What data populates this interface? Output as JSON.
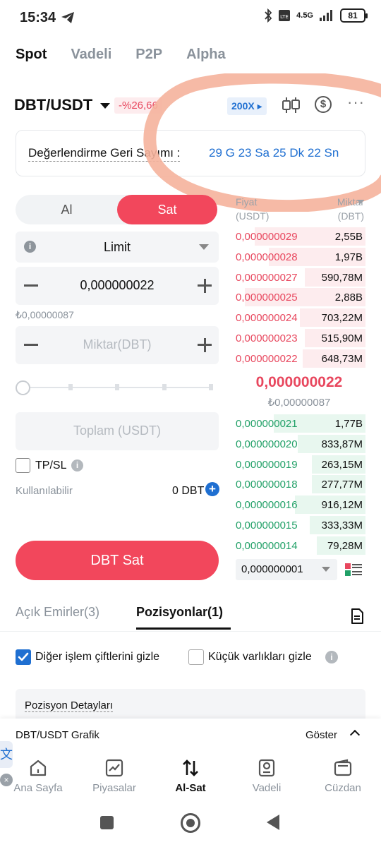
{
  "status_bar": {
    "time": "15:34",
    "battery": "81",
    "network": "4.5G"
  },
  "top_tabs": [
    {
      "label": "Spot",
      "active": true
    },
    {
      "label": "Vadeli",
      "active": false
    },
    {
      "label": "P2P",
      "active": false
    },
    {
      "label": "Alpha",
      "active": false
    }
  ],
  "pair": {
    "name": "DBT/USDT",
    "change": "-%26,66",
    "leverage": "200X"
  },
  "countdown": {
    "label": "Değerlendirme Geri Sayımı :",
    "value": "29 G 23 Sa 25 Dk 22 Sn"
  },
  "order_form": {
    "buy_label": "Al",
    "sell_label": "Sat",
    "order_type": "Limit",
    "price_value": "0,000000022",
    "price_sub": "₺0,00000087",
    "amount_placeholder": "Miktar(DBT)",
    "total_placeholder": "Toplam (USDT)",
    "tpsl_label": "TP/SL",
    "available_label": "Kullanılabilir",
    "available_value": "0 DBT",
    "sell_button": "DBT Sat",
    "slider_percent": 0
  },
  "orderbook": {
    "price_header": "Fiyat\n(USDT)",
    "amount_header": "Miktar\n(DBT)",
    "asks": [
      {
        "price": "0,000000029",
        "amount": "2,55B",
        "depth": 0.27
      },
      {
        "price": "0,000000028",
        "amount": "1,97B",
        "depth": 0.21
      },
      {
        "price": "0,000000027",
        "amount": "590,78M",
        "depth": 0.06
      },
      {
        "price": "0,000000025",
        "amount": "2,88B",
        "depth": 0.31
      },
      {
        "price": "0,000000024",
        "amount": "703,22M",
        "depth": 0.08
      },
      {
        "price": "0,000000023",
        "amount": "515,90M",
        "depth": 0.06
      },
      {
        "price": "0,000000022",
        "amount": "648,73M",
        "depth": 0.07
      }
    ],
    "last_price": "0,000000022",
    "last_price_try": "₺0,00000087",
    "bids": [
      {
        "price": "0,000000021",
        "amount": "1,77B",
        "depth": 0.19
      },
      {
        "price": "0,000000020",
        "amount": "833,87M",
        "depth": 0.09
      },
      {
        "price": "0,000000019",
        "amount": "263,15M",
        "depth": 0.03
      },
      {
        "price": "0,000000018",
        "amount": "277,77M",
        "depth": 0.03
      },
      {
        "price": "0,000000016",
        "amount": "916,12M",
        "depth": 0.1
      },
      {
        "price": "0,000000015",
        "amount": "333,33M",
        "depth": 0.04
      },
      {
        "price": "0,000000014",
        "amount": "79,28M",
        "depth": 0.01
      }
    ],
    "precision": "0,000000001"
  },
  "bottom_tabs": {
    "open_orders": "Açık Emirler(3)",
    "positions": "Pozisyonlar(1)"
  },
  "filters": {
    "hide_other_pairs": "Diğer işlem çiftlerini gizle",
    "hide_other_pairs_checked": true,
    "hide_small": "Küçük varlıkları gizle",
    "hide_small_checked": false
  },
  "position_card": {
    "title": "Pozisyon Detayları"
  },
  "chart_bar": {
    "title": "DBT/USDT Grafik",
    "show": "Göster"
  },
  "translate_widget": {
    "glyph": "文"
  },
  "nav": [
    {
      "label": "Ana Sayfa",
      "icon": "home-icon",
      "active": false
    },
    {
      "label": "Piyasalar",
      "icon": "chart-icon",
      "active": false
    },
    {
      "label": "Al-Sat",
      "icon": "trade-arrows-icon",
      "active": true
    },
    {
      "label": "Vadeli",
      "icon": "futures-icon",
      "active": false
    },
    {
      "label": "Cüzdan",
      "icon": "wallet-icon",
      "active": false
    }
  ],
  "colors": {
    "sell_red": "#f2475c",
    "ask_red": "#e8475e",
    "bid_green": "#21a067",
    "link_blue": "#1f6fd1",
    "highlight_orange": "#f5b39c"
  }
}
